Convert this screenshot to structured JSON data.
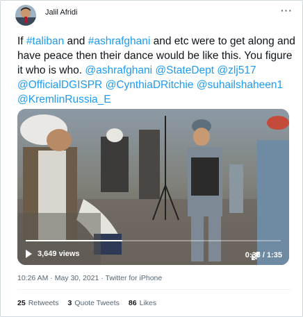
{
  "author": {
    "name": "Jalil Afridi"
  },
  "more_icon": "more-horizontal-icon",
  "tweet_text": {
    "p1": "If ",
    "tag1": "#taliban",
    "p2": " and ",
    "tag2": "#ashrafghani",
    "p3": " and etc were to get along and have peace then their dance would be like this. You figure it who is who. ",
    "m1": "@ashrafghani",
    "m2": "@StateDept",
    "m3": "@zlj517",
    "m4": "@OfficialDGISPR",
    "m5": "@CynthiaDRitchie",
    "m6": "@suhailshaheen1",
    "m7": "@KremlinRussia_E"
  },
  "video": {
    "views": "3,649 views",
    "time": "0:36 / 1:35",
    "progress_fraction": 0.379,
    "volume_icon": "volume-icon",
    "fullscreen_icon": "fullscreen-icon",
    "play_icon": "play-icon"
  },
  "meta": {
    "time": "10:26 AM",
    "sep": " · ",
    "date": "May 30, 2021",
    "source": "Twitter for iPhone"
  },
  "stats": {
    "retweets_count": "25",
    "retweets_label": "Retweets",
    "quotes_count": "3",
    "quotes_label": "Quote Tweets",
    "likes_count": "86",
    "likes_label": "Likes"
  },
  "colors": {
    "link": "#1d9bf0",
    "secondary": "#536471",
    "text": "#0f1419"
  }
}
